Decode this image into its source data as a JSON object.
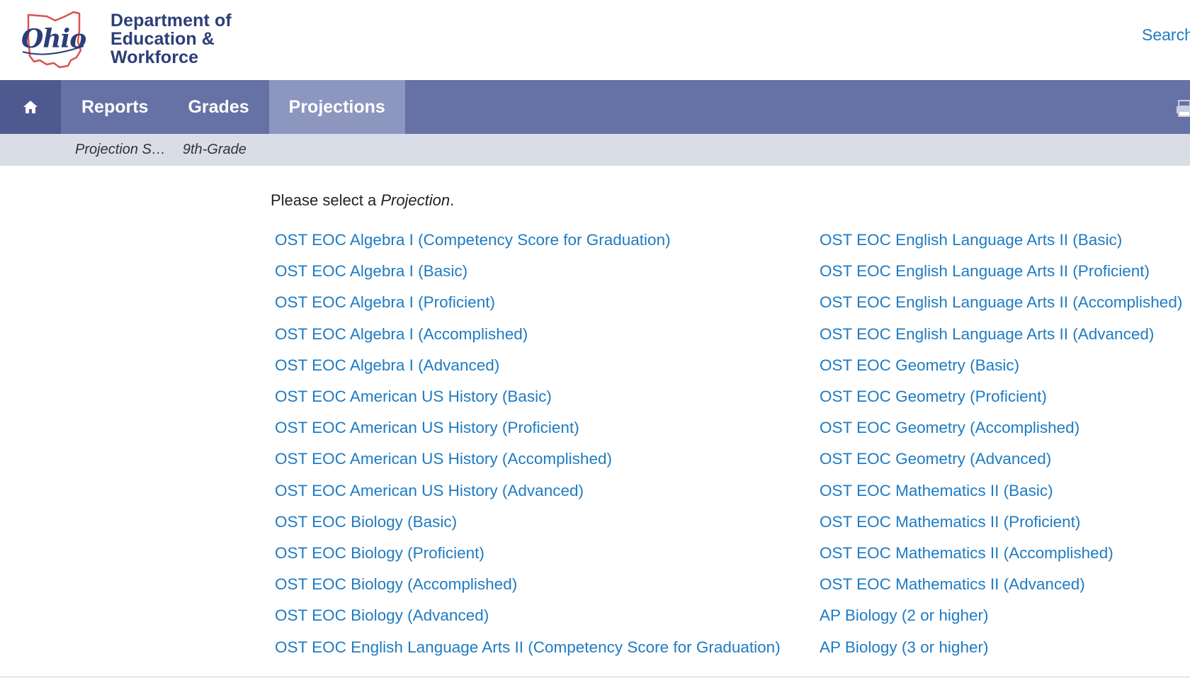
{
  "header": {
    "logo_script": "Ohio",
    "org_lines": [
      "Department of",
      "Education &",
      "Workforce"
    ],
    "search_label": "Search"
  },
  "nav": {
    "home_icon": "home-icon",
    "items": [
      "Reports",
      "Grades",
      "Projections"
    ],
    "active": "Projections",
    "print_icon": "print-icon"
  },
  "breadcrumb": [
    "Projection S…",
    "9th-Grade"
  ],
  "content": {
    "prompt_prefix": "Please select a ",
    "prompt_emphasis": "Projection",
    "prompt_suffix": ".",
    "left_links": [
      "OST EOC Algebra I (Competency Score for Graduation)",
      "OST EOC Algebra I (Basic)",
      "OST EOC Algebra I (Proficient)",
      "OST EOC Algebra I (Accomplished)",
      "OST EOC Algebra I (Advanced)",
      "OST EOC American US History (Basic)",
      "OST EOC American US History (Proficient)",
      "OST EOC American US History (Accomplished)",
      "OST EOC American US History (Advanced)",
      "OST EOC Biology (Basic)",
      "OST EOC Biology (Proficient)",
      "OST EOC Biology (Accomplished)",
      "OST EOC Biology (Advanced)",
      "OST EOC English Language Arts II (Competency Score for Graduation)"
    ],
    "right_links": [
      "OST EOC English Language Arts II (Basic)",
      "OST EOC English Language Arts II (Proficient)",
      "OST EOC English Language Arts II (Accomplished)",
      "OST EOC English Language Arts II (Advanced)",
      "OST EOC Geometry (Basic)",
      "OST EOC Geometry (Proficient)",
      "OST EOC Geometry (Accomplished)",
      "OST EOC Geometry (Advanced)",
      "OST EOC Mathematics II (Basic)",
      "OST EOC Mathematics II (Proficient)",
      "OST EOC Mathematics II (Accomplished)",
      "OST EOC Mathematics II (Advanced)",
      "AP Biology (2 or higher)",
      "AP Biology (3 or higher)"
    ]
  },
  "colors": {
    "nav_bg": "#6672a6",
    "nav_home_bg": "#4e5a8f",
    "nav_active_bg": "#8c96bf",
    "breadcrumb_bg": "#d9dde8",
    "link": "#1f7bc1",
    "brand": "#2c3e78",
    "state_outline": "#d9534f"
  }
}
